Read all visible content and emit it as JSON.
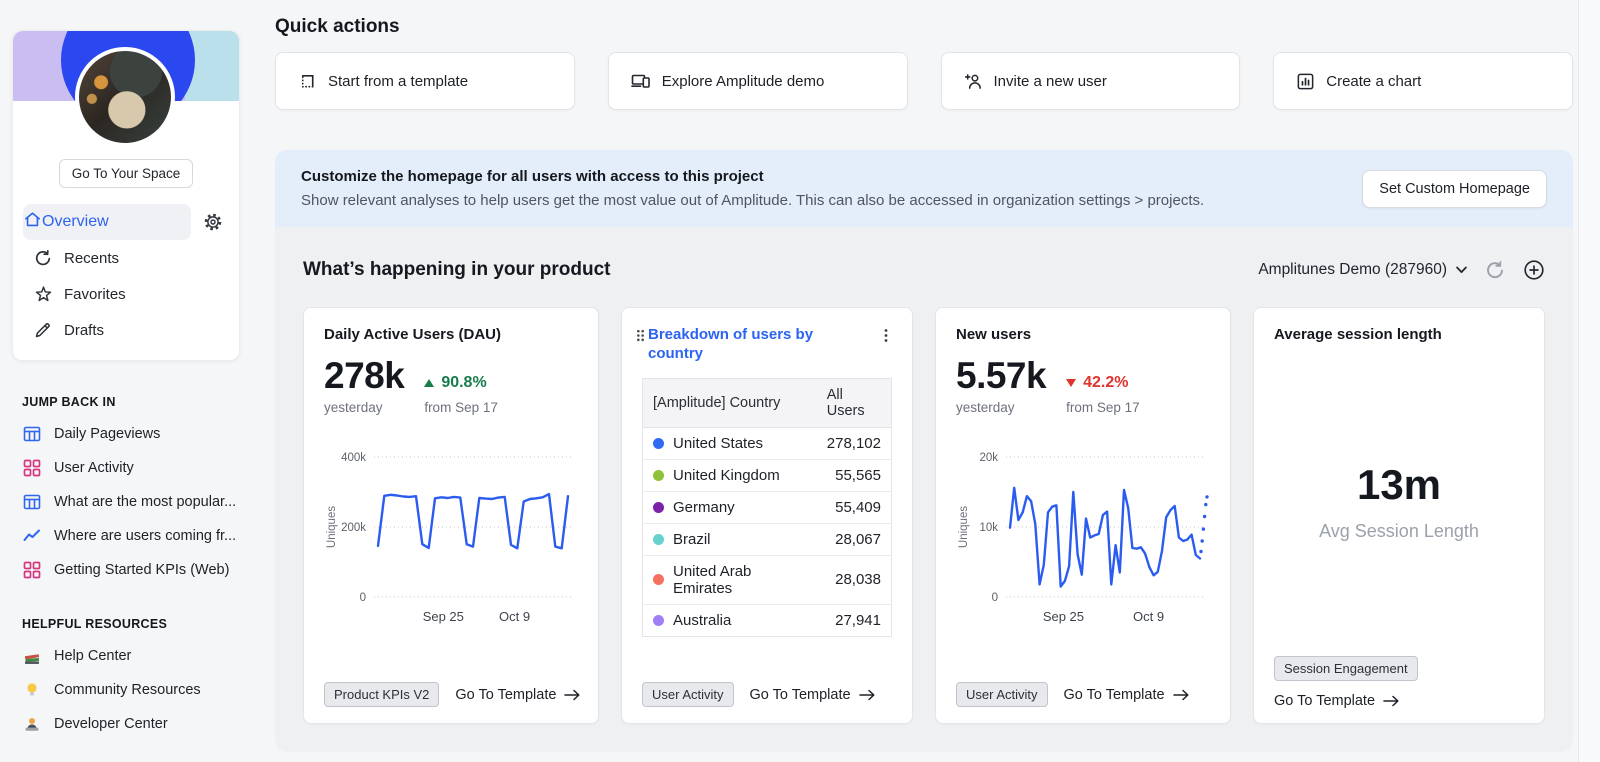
{
  "sidebar": {
    "space_button": "Go To Your Space",
    "menu": [
      {
        "label": "Overview",
        "active": true
      },
      {
        "label": "Recents",
        "active": false
      },
      {
        "label": "Favorites",
        "active": false
      },
      {
        "label": "Drafts",
        "active": false
      }
    ],
    "jump_back_in": {
      "title": "JUMP BACK IN",
      "items": [
        {
          "label": "Daily Pageviews",
          "icon": "table-chart-icon",
          "color": "#2f66f1"
        },
        {
          "label": "User Activity",
          "icon": "dashboard-icon",
          "color": "#d6367f"
        },
        {
          "label": "What are the most popular...",
          "icon": "table-chart-icon",
          "color": "#2f66f1"
        },
        {
          "label": "Where are users coming fr...",
          "icon": "line-chart-icon",
          "color": "#2f66f1"
        },
        {
          "label": "Getting Started KPIs (Web)",
          "icon": "dashboard-icon",
          "color": "#d6367f"
        }
      ]
    },
    "helpful_resources": {
      "title": "HELPFUL RESOURCES",
      "items": [
        {
          "label": "Help Center",
          "icon": "books-icon"
        },
        {
          "label": "Community Resources",
          "icon": "lightbulb-icon"
        },
        {
          "label": "Developer Center",
          "icon": "technologist-icon"
        }
      ]
    }
  },
  "quick_actions": {
    "title": "Quick actions",
    "buttons": [
      {
        "label": "Start from a template",
        "icon": "template-icon"
      },
      {
        "label": "Explore Amplitude demo",
        "icon": "devices-icon"
      },
      {
        "label": "Invite a new user",
        "icon": "add-user-icon"
      },
      {
        "label": "Create a chart",
        "icon": "bar-chart-icon"
      }
    ]
  },
  "customize_banner": {
    "title": "Customize the homepage for all users with access to this project",
    "subtitle": "Show relevant analyses to help users get the most value out of Amplitude. This can also be accessed in organization settings > projects.",
    "button": "Set Custom Homepage"
  },
  "section": {
    "title": "What’s happening in your product",
    "project_selector": "Amplitunes Demo (287960)"
  },
  "cards": {
    "dau": {
      "title": "Daily Active Users (DAU)",
      "value": "278k",
      "period": "yesterday",
      "delta": "90.8%",
      "delta_direction": "up",
      "compare": "from Sep 17",
      "tag": "Product KPIs V2",
      "link": "Go To Template"
    },
    "breakdown": {
      "title": "Breakdown of users by country",
      "columns": [
        "[Amplitude] Country",
        "All Users"
      ],
      "rows": [
        {
          "country": "United States",
          "value": "278,102",
          "dot_color": "#316bf2"
        },
        {
          "country": "United Kingdom",
          "value": "55,565",
          "dot_color": "#8fc13b"
        },
        {
          "country": "Germany",
          "value": "55,409",
          "dot_color": "#7d22a8"
        },
        {
          "country": "Brazil",
          "value": "28,067",
          "dot_color": "#66d1ce"
        },
        {
          "country": "United Arab Emirates",
          "value": "28,038",
          "dot_color": "#f4715f"
        },
        {
          "country": "Australia",
          "value": "27,941",
          "dot_color": "#a07ef5"
        }
      ],
      "tag": "User Activity",
      "link": "Go To Template"
    },
    "new_users": {
      "title": "New users",
      "value": "5.57k",
      "period": "yesterday",
      "delta": "42.2%",
      "delta_direction": "down",
      "compare": "from Sep 17",
      "tag": "User Activity",
      "link": "Go To Template"
    },
    "session": {
      "title": "Average session length",
      "value": "13m",
      "label": "Avg Session Length",
      "tag": "Session Engagement",
      "link": "Go To Template"
    }
  },
  "chart_data": [
    {
      "id": "dau_chart",
      "type": "line",
      "title": "Daily Active Users (DAU)",
      "current": "278k yesterday",
      "change": "+90.8% from Sep 17",
      "ylabel": "Uniques",
      "ylim": [
        0,
        400000
      ],
      "color": "#2b5cf0",
      "grid": true,
      "yticks": [
        {
          "v": 0,
          "label": "0"
        },
        {
          "v": 200000,
          "label": "200k"
        },
        {
          "v": 400000,
          "label": "400k"
        }
      ],
      "x_labels": [
        {
          "label": "Sep 25",
          "pos": 0.35
        },
        {
          "label": "Oct 9",
          "pos": 0.71
        }
      ],
      "values": [
        146000,
        289000,
        292000,
        290000,
        287000,
        286000,
        288000,
        151000,
        140000,
        282000,
        285000,
        283000,
        286000,
        284000,
        151000,
        144000,
        283000,
        281000,
        280000,
        284000,
        286000,
        149000,
        139000,
        273000,
        280000,
        282000,
        285000,
        294000,
        144000,
        139000,
        288000
      ]
    },
    {
      "id": "country_breakdown",
      "type": "table",
      "title": "Breakdown of users by country",
      "columns": [
        "[Amplitude] Country",
        "All Users"
      ],
      "rows": [
        [
          "United States",
          278102
        ],
        [
          "United Kingdom",
          55565
        ],
        [
          "Germany",
          55409
        ],
        [
          "Brazil",
          28067
        ],
        [
          "United Arab Emirates",
          28038
        ],
        [
          "Australia",
          27941
        ]
      ]
    },
    {
      "id": "new_users_chart",
      "type": "line",
      "title": "New users",
      "current": "5.57k yesterday",
      "change": "-42.2% from Sep 17",
      "ylabel": "Uniques",
      "ylim": [
        0,
        20000
      ],
      "color": "#2b5cf0",
      "grid": true,
      "yticks": [
        {
          "v": 0,
          "label": "0"
        },
        {
          "v": 10000,
          "label": "10k"
        },
        {
          "v": 20000,
          "label": "20k"
        }
      ],
      "x_labels": [
        {
          "label": "Sep 25",
          "pos": 0.29
        },
        {
          "label": "Oct 9",
          "pos": 0.72
        }
      ],
      "values": [
        9900,
        15600,
        11000,
        12100,
        14400,
        13700,
        10400,
        1800,
        4600,
        12100,
        12900,
        13100,
        1500,
        2300,
        4400,
        15000,
        6100,
        3200,
        11200,
        8500,
        8800,
        9000,
        11700,
        12200,
        1800,
        7400,
        3500,
        15300,
        12700,
        7000,
        6900,
        7100,
        6200,
        4300,
        3100,
        3600,
        6600,
        11400,
        12400,
        13000,
        8500,
        8000,
        8200,
        8900,
        6000,
        5500
      ],
      "forecast": [
        6500,
        8000,
        9700,
        11500,
        13200,
        14300
      ]
    },
    {
      "id": "avg_session_length",
      "type": "stat",
      "title": "Average session length",
      "value": "13m",
      "label": "Avg Session Length"
    }
  ]
}
